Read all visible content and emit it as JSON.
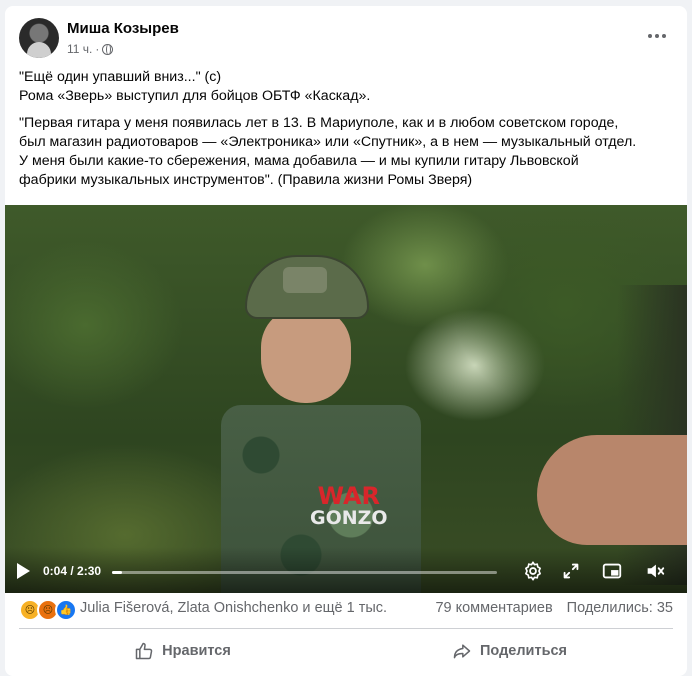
{
  "post": {
    "author": "Миша Козырев",
    "time": "11 ч.",
    "dot": "·",
    "text_lines": [
      "\"Ещё один упавший вниз...\" (с)",
      "Рома «Зверь» выступил для бойцов ОБТФ «Каскад»."
    ],
    "quote_lines": [
      "\"Первая гитара у меня появилась лет в 13. В Мариуполе, как и в любом советском городе,",
      "был магазин радиотоваров — «Электроника» или «Спутник», а в нем — музыкальный отдел.",
      "У меня были какие-то сбережения, мама добавила — и мы купили гитару Львовской",
      "фабрики музыкальных инструментов\". (Правила жизни Ромы Зверя)"
    ]
  },
  "video": {
    "watermark_top": "WAR",
    "watermark_bottom": "GONZO",
    "time_display": "0:04 / 2:30",
    "progress": 0.027
  },
  "reactions": {
    "icons": [
      "sad-icon",
      "angry-icon",
      "like-icon"
    ],
    "colors": [
      "#f7b125",
      "#e9710f",
      "#1877f2"
    ],
    "names": "Julia Fišerová, Zlata Onishchenko и ещё 1 тыс.",
    "comments": "79 комментариев",
    "shares": "Поделились: 35"
  },
  "actions": {
    "like_label": "Нравится",
    "share_label": "Поделиться"
  }
}
